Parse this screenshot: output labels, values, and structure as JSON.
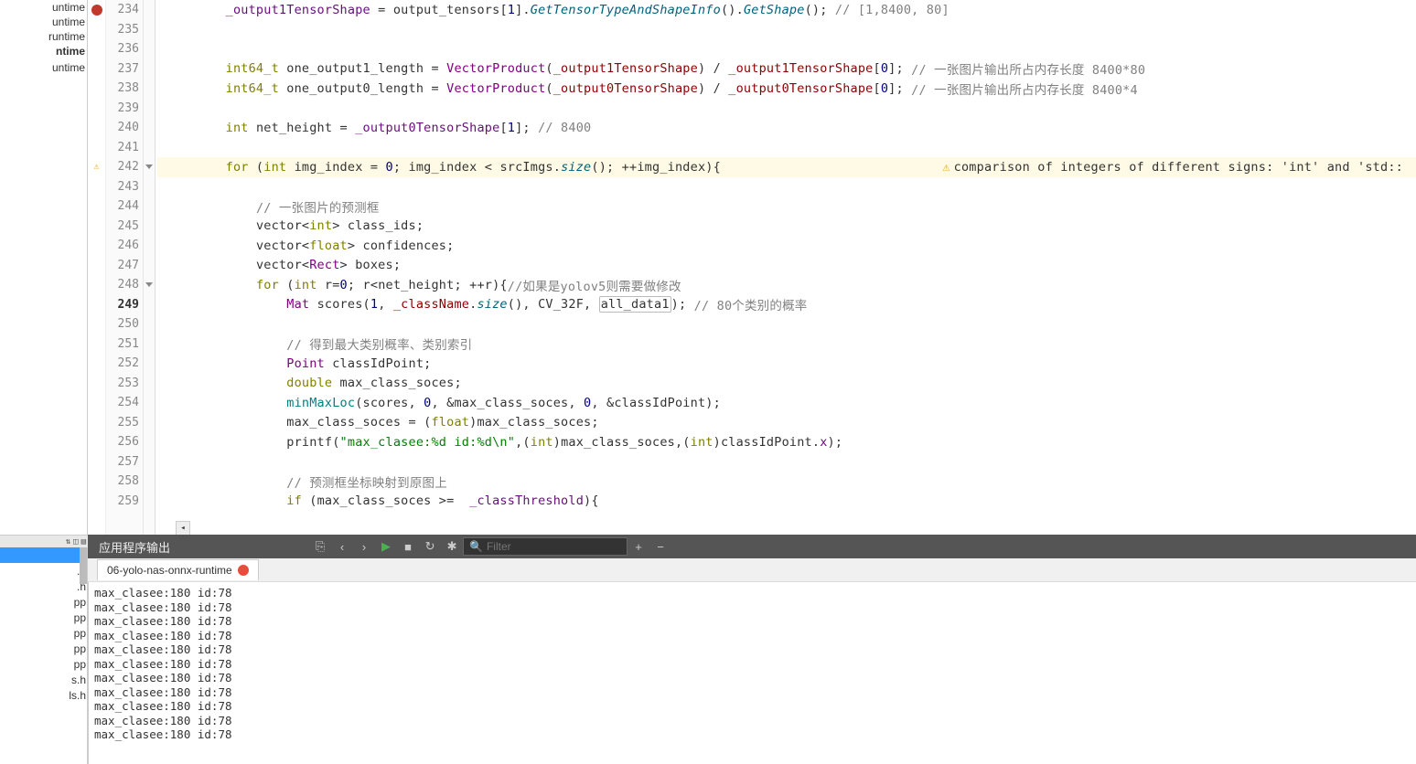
{
  "filetree": {
    "items": [
      {
        "label": "untime",
        "bold": false
      },
      {
        "label": "untime",
        "bold": false
      },
      {
        "label": "runtime",
        "bold": false
      },
      {
        "label": "ntime",
        "bold": true
      },
      {
        "label": "",
        "bold": false
      },
      {
        "label": "untime",
        "bold": false
      }
    ],
    "selected_index": 0
  },
  "lines": {
    "start": 234,
    "end": 259,
    "current": 249,
    "warn_line": 242,
    "breakpoint_line": 234,
    "fold_lines": [
      242,
      248,
      260
    ],
    "warning_text": "comparison of integers of different signs: 'int' and 'std::"
  },
  "code": {
    "234": {
      "pre": "        ",
      "tokens": [
        [
          "mem",
          "_output1TensorShape"
        ],
        [
          "op",
          " = "
        ],
        [
          "ident",
          "output_tensors"
        ],
        [
          "op",
          "["
        ],
        [
          "num",
          "1"
        ],
        [
          "op",
          "]."
        ],
        [
          "fn",
          "GetTensorTypeAndShapeInfo"
        ],
        [
          "op",
          "()."
        ],
        [
          "fn",
          "GetShape"
        ],
        [
          "op",
          "(); "
        ],
        [
          "cmt",
          "// [1,8400, 80]"
        ]
      ]
    },
    "235": {
      "pre": "",
      "tokens": []
    },
    "236": {
      "pre": "",
      "tokens": []
    },
    "237": {
      "pre": "        ",
      "tokens": [
        [
          "kw",
          "int64_t"
        ],
        [
          "op",
          " "
        ],
        [
          "ident",
          "one_output1_length"
        ],
        [
          "op",
          " = "
        ],
        [
          "type",
          "VectorProduct"
        ],
        [
          "op",
          "("
        ],
        [
          "maroon",
          "_output1TensorShape"
        ],
        [
          "op",
          ") / "
        ],
        [
          "maroon",
          "_output1TensorShape"
        ],
        [
          "op",
          "["
        ],
        [
          "num",
          "0"
        ],
        [
          "op",
          "]; "
        ],
        [
          "cmt",
          "// 一张图片输出所占内存长度 8400*80"
        ]
      ]
    },
    "238": {
      "pre": "        ",
      "tokens": [
        [
          "kw",
          "int64_t"
        ],
        [
          "op",
          " "
        ],
        [
          "ident",
          "one_output0_length"
        ],
        [
          "op",
          " = "
        ],
        [
          "type",
          "VectorProduct"
        ],
        [
          "op",
          "("
        ],
        [
          "maroon",
          "_output0TensorShape"
        ],
        [
          "op",
          ") / "
        ],
        [
          "maroon",
          "_output0TensorShape"
        ],
        [
          "op",
          "["
        ],
        [
          "num",
          "0"
        ],
        [
          "op",
          "]; "
        ],
        [
          "cmt",
          "// 一张图片输出所占内存长度 8400*4"
        ]
      ]
    },
    "239": {
      "pre": "",
      "tokens": []
    },
    "240": {
      "pre": "        ",
      "tokens": [
        [
          "kw",
          "int"
        ],
        [
          "op",
          " "
        ],
        [
          "ident",
          "net_height"
        ],
        [
          "op",
          " = "
        ],
        [
          "mem",
          "_output0TensorShape"
        ],
        [
          "op",
          "["
        ],
        [
          "num",
          "1"
        ],
        [
          "op",
          "]; "
        ],
        [
          "cmt",
          "// 8400"
        ]
      ]
    },
    "241": {
      "pre": "",
      "tokens": []
    },
    "242": {
      "pre": "        ",
      "tokens": [
        [
          "kw",
          "for"
        ],
        [
          "op",
          " ("
        ],
        [
          "kw",
          "int"
        ],
        [
          "op",
          " "
        ],
        [
          "ident",
          "img_index"
        ],
        [
          "op",
          " = "
        ],
        [
          "num",
          "0"
        ],
        [
          "op",
          "; "
        ],
        [
          "ident",
          "img_index"
        ],
        [
          "op",
          " < "
        ],
        [
          "ident",
          "srcImgs"
        ],
        [
          "op",
          "."
        ],
        [
          "fn",
          "size"
        ],
        [
          "op",
          "(); ++"
        ],
        [
          "ident",
          "img_index"
        ],
        [
          "op",
          "){"
        ]
      ]
    },
    "243": {
      "pre": "",
      "tokens": []
    },
    "244": {
      "pre": "            ",
      "tokens": [
        [
          "cmt",
          "// 一张图片的预测框"
        ]
      ]
    },
    "245": {
      "pre": "            ",
      "tokens": [
        [
          "ident",
          "vector"
        ],
        [
          "op",
          "<"
        ],
        [
          "kw",
          "int"
        ],
        [
          "op",
          "> "
        ],
        [
          "ident",
          "class_ids"
        ],
        [
          "op",
          ";"
        ]
      ]
    },
    "246": {
      "pre": "            ",
      "tokens": [
        [
          "ident",
          "vector"
        ],
        [
          "op",
          "<"
        ],
        [
          "kw",
          "float"
        ],
        [
          "op",
          "> "
        ],
        [
          "ident",
          "confidences"
        ],
        [
          "op",
          ";"
        ]
      ]
    },
    "247": {
      "pre": "            ",
      "tokens": [
        [
          "ident",
          "vector"
        ],
        [
          "op",
          "<"
        ],
        [
          "type",
          "Rect"
        ],
        [
          "op",
          "> "
        ],
        [
          "ident",
          "boxes"
        ],
        [
          "op",
          ";"
        ]
      ]
    },
    "248": {
      "pre": "            ",
      "tokens": [
        [
          "kw",
          "for"
        ],
        [
          "op",
          " ("
        ],
        [
          "kw",
          "int"
        ],
        [
          "op",
          " "
        ],
        [
          "ident",
          "r"
        ],
        [
          "op",
          "="
        ],
        [
          "num",
          "0"
        ],
        [
          "op",
          "; "
        ],
        [
          "ident",
          "r"
        ],
        [
          "op",
          "<"
        ],
        [
          "ident",
          "net_height"
        ],
        [
          "op",
          "; ++"
        ],
        [
          "ident",
          "r"
        ],
        [
          "op",
          "){"
        ],
        [
          "cmt",
          "//如果是yolov5则需要做修改"
        ]
      ]
    },
    "249": {
      "pre": "                ",
      "tokens": [
        [
          "type",
          "Mat"
        ],
        [
          "op",
          " "
        ],
        [
          "ident",
          "scores"
        ],
        [
          "op",
          "("
        ],
        [
          "num",
          "1"
        ],
        [
          "op",
          ", "
        ],
        [
          "maroon",
          "_className"
        ],
        [
          "op",
          "."
        ],
        [
          "fn",
          "size"
        ],
        [
          "op",
          "(), "
        ],
        [
          "ident",
          "CV_32F"
        ],
        [
          "op",
          ", "
        ],
        [
          "box",
          "all_data1"
        ],
        [
          "op",
          "); "
        ],
        [
          "cmt",
          "// 80个类别的概率"
        ]
      ]
    },
    "250": {
      "pre": "",
      "tokens": []
    },
    "251": {
      "pre": "                ",
      "tokens": [
        [
          "cmt",
          "// 得到最大类别概率、类别索引"
        ]
      ]
    },
    "252": {
      "pre": "                ",
      "tokens": [
        [
          "type",
          "Point"
        ],
        [
          "op",
          " "
        ],
        [
          "ident",
          "classIdPoint"
        ],
        [
          "op",
          ";"
        ]
      ]
    },
    "253": {
      "pre": "                ",
      "tokens": [
        [
          "kw",
          "double"
        ],
        [
          "op",
          " "
        ],
        [
          "ident",
          "max_class_soces"
        ],
        [
          "op",
          ";"
        ]
      ]
    },
    "254": {
      "pre": "                ",
      "tokens": [
        [
          "greenfn",
          "minMaxLoc"
        ],
        [
          "op",
          "("
        ],
        [
          "ident",
          "scores"
        ],
        [
          "op",
          ", "
        ],
        [
          "num",
          "0"
        ],
        [
          "op",
          ", &"
        ],
        [
          "ident",
          "max_class_soces"
        ],
        [
          "op",
          ", "
        ],
        [
          "num",
          "0"
        ],
        [
          "op",
          ", &"
        ],
        [
          "ident",
          "classIdPoint"
        ],
        [
          "op",
          ");"
        ]
      ]
    },
    "255": {
      "pre": "                ",
      "tokens": [
        [
          "ident",
          "max_class_soces"
        ],
        [
          "op",
          " = ("
        ],
        [
          "kw",
          "float"
        ],
        [
          "op",
          ")"
        ],
        [
          "ident",
          "max_class_soces"
        ],
        [
          "op",
          ";"
        ]
      ]
    },
    "256": {
      "pre": "                ",
      "tokens": [
        [
          "ident",
          "printf"
        ],
        [
          "op",
          "("
        ],
        [
          "str",
          "\"max_clasee:%d id:%d\\n\""
        ],
        [
          "op",
          ",("
        ],
        [
          "kw",
          "int"
        ],
        [
          "op",
          ")"
        ],
        [
          "ident",
          "max_class_soces"
        ],
        [
          "op",
          ",("
        ],
        [
          "kw",
          "int"
        ],
        [
          "op",
          ")"
        ],
        [
          "ident",
          "classIdPoint"
        ],
        [
          "op",
          "."
        ],
        [
          "mem",
          "x"
        ],
        [
          "op",
          ");"
        ]
      ]
    },
    "257": {
      "pre": "",
      "tokens": []
    },
    "258": {
      "pre": "                ",
      "tokens": [
        [
          "cmt",
          "// 预测框坐标映射到原图上"
        ]
      ]
    },
    "259": {
      "pre": "                ",
      "tokens": [
        [
          "kw",
          "if"
        ],
        [
          "op",
          " ("
        ],
        [
          "ident",
          "max_class_soces"
        ],
        [
          "op",
          " >=  "
        ],
        [
          "mem",
          "_classThreshold"
        ],
        [
          "op",
          "){"
        ]
      ]
    }
  },
  "bottom": {
    "title": "应用程序输出",
    "tab_label": "06-yolo-nas-onnx-runtime",
    "filter_placeholder": "Filter",
    "output_line": "max_clasee:180 id:78",
    "output_count": 11
  },
  "filelist2": {
    "items": [
      "p",
      ".h",
      ".h",
      "pp",
      "pp",
      "pp",
      "pp",
      "pp",
      "s.h",
      "ls.h"
    ],
    "selected_index": 0
  }
}
